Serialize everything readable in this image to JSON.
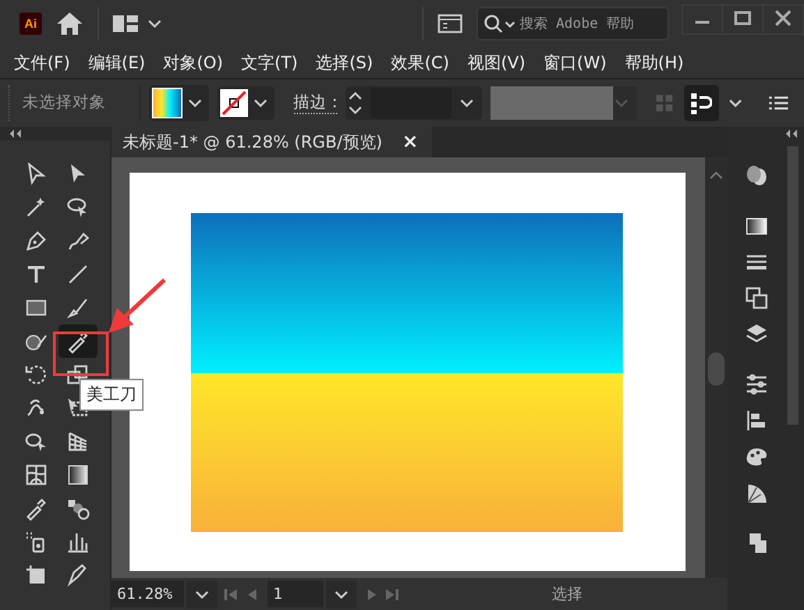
{
  "app": {
    "logo": "Ai"
  },
  "search": {
    "placeholder": "搜索 Adobe 帮助"
  },
  "menu": [
    "文件(F)",
    "编辑(E)",
    "对象(O)",
    "文字(T)",
    "选择(S)",
    "效果(C)",
    "视图(V)",
    "窗口(W)",
    "帮助(H)"
  ],
  "control_bar": {
    "selection": "未选择对象",
    "stroke_label": "描边 :"
  },
  "document_tab": {
    "title": "未标题-1* @ 61.28% (RGB/预览)",
    "close": "×"
  },
  "tools": [
    {
      "selected": false
    },
    {
      "selected": false
    },
    {
      "selected": false
    },
    {
      "selected": false
    },
    {
      "selected": false
    },
    {
      "selected": false
    },
    {
      "selected": false
    },
    {
      "selected": false
    },
    {
      "selected": false
    },
    {
      "selected": false
    },
    {
      "selected": false
    },
    {
      "selected": true
    },
    {
      "selected": false
    },
    {
      "selected": false
    },
    {
      "selected": false
    },
    {
      "selected": false
    },
    {
      "selected": false
    },
    {
      "selected": false
    },
    {
      "selected": false
    },
    {
      "selected": false
    },
    {
      "selected": false
    },
    {
      "selected": false
    },
    {
      "selected": false
    },
    {
      "selected": false
    },
    {
      "selected": false
    },
    {
      "selected": false
    }
  ],
  "tooltip": "美工刀",
  "status_bar": {
    "zoom": "61.28%",
    "page": "1",
    "tool": "选择"
  }
}
